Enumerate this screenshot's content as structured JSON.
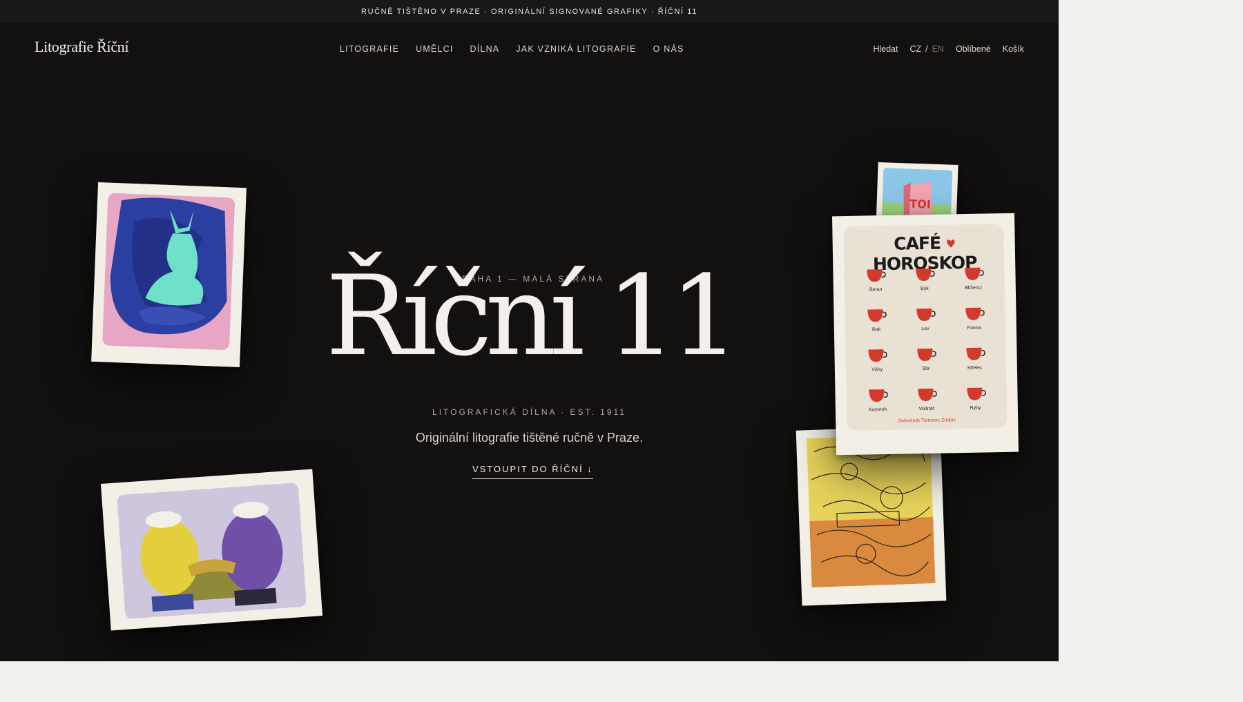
{
  "announcement": "RUČNĚ TIŠTĚNO V PRAZE · ORIGINÁLNÍ SIGNOVANÉ GRAFIKY · ŘÍČNÍ 11",
  "nav": {
    "logo": "Litografie Říční",
    "menu": [
      "LITOGRAFIE",
      "UMĚLCI",
      "DÍLNA",
      "JAK VZNIKÁ LITOGRAFIE",
      "O NÁS"
    ],
    "search": "Hledat",
    "lang_cz": "CZ",
    "lang_sep": "/",
    "lang_en": "EN",
    "favorites": "Oblíbené",
    "cart": "Košík"
  },
  "hero": {
    "eyebrow": "PRAHA 1 — MALÁ STRANA",
    "title": "Říční 11",
    "subline": "LITOGRAFICKÁ DÍLNA · EST. 1911",
    "tagline": "Originální litografie tištěné ručně v Praze.",
    "cta": "VSTOUPIT DO ŘÍČNÍ ↓"
  },
  "prints": {
    "small_print_text": "TOI",
    "horoscope": {
      "title_left": "CAFÉ",
      "cup": "♥",
      "title_right": "HOROSKOP",
      "signs": [
        "Beran",
        "Býk",
        "Blíženci",
        "Rak",
        "Lev",
        "Panna",
        "Váhy",
        "Štír",
        "Střelec",
        "Kozoroh",
        "Vodnář",
        "Ryby"
      ],
      "footer": "Zvěrokruh·Tierkreis·Zodiac"
    }
  },
  "colors": {
    "page_background": "#121110",
    "accent_red": "#d23a2c",
    "paper": "#f2efe6"
  }
}
